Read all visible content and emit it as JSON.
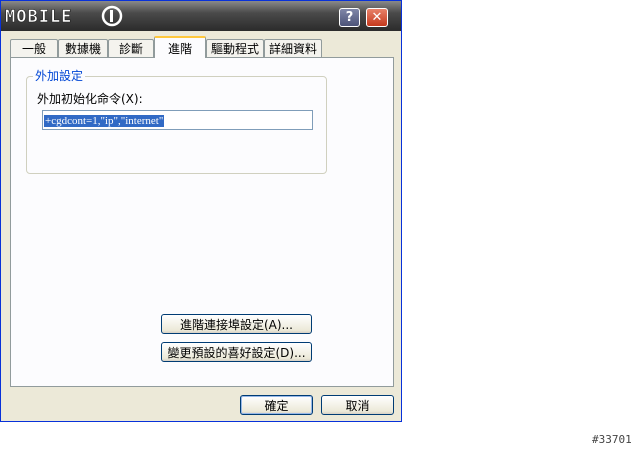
{
  "window": {
    "title_logo": "MOBILE01",
    "help_label": "?",
    "close_label": "✕"
  },
  "tabs": [
    {
      "label": "一般",
      "active": false
    },
    {
      "label": "數據機",
      "active": false
    },
    {
      "label": "診斷",
      "active": false
    },
    {
      "label": "進階",
      "active": true
    },
    {
      "label": "驅動程式",
      "active": false
    },
    {
      "label": "詳細資料",
      "active": false
    }
  ],
  "extra_settings": {
    "group_title": "外加設定",
    "field_label": "外加初始化命令(X):",
    "field_value": "+cgdcont=1,\"ip\",\"internet\""
  },
  "buttons": {
    "advanced_port": "進階連接埠設定(A)...",
    "change_defaults": "變更預設的喜好設定(D)...",
    "ok": "確定",
    "cancel": "取消"
  },
  "watermark": "#33701",
  "colors": {
    "group_title": "#0046d5",
    "selection": "#316ac5",
    "active_tab_accent": "#ffc83c"
  }
}
